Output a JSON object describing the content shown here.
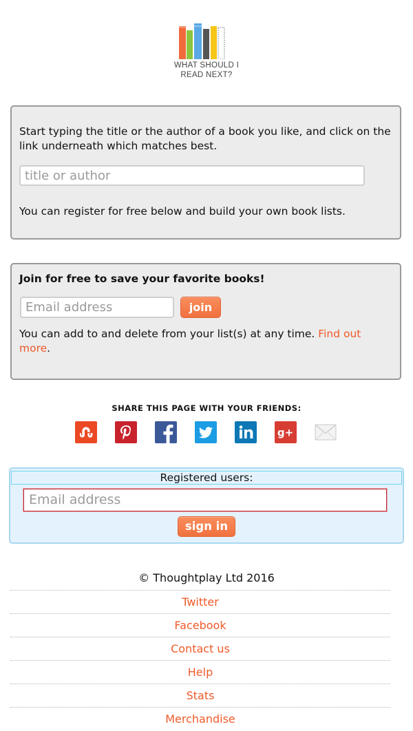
{
  "logo": {
    "line1": "WHAT SHOULD I",
    "line2": "READ NEXT?"
  },
  "search_panel": {
    "intro": "Start typing the title or the author of a book you like, and click on the link underneath which matches best.",
    "placeholder": "title or author",
    "register_note": "You can register for free below and build your own book lists."
  },
  "join_panel": {
    "title": "Join for free to save your favorite books!",
    "email_placeholder": "Email address",
    "join_label": "join",
    "note": "You can add to and delete from your list(s) at any time. ",
    "find_out_more": "Find out more",
    "period": "."
  },
  "share": {
    "title": "SHARE THIS PAGE WITH YOUR FRIENDS:",
    "icons": [
      "stumbleupon-icon",
      "pinterest-icon",
      "facebook-icon",
      "twitter-icon",
      "linkedin-icon",
      "google-plus-icon",
      "email-icon"
    ]
  },
  "registered": {
    "title": "Registered users:",
    "email_placeholder": "Email address",
    "signin_label": "sign in"
  },
  "footer": {
    "copyright": "© Thoughtplay Ltd 2016",
    "links": [
      "Twitter",
      "Facebook",
      "Contact us",
      "Help",
      "Stats",
      "Merchandise"
    ]
  },
  "colors": {
    "accent": "#ef5a2a",
    "button": "#f47e4b",
    "panel_bg": "#ececec",
    "register_bg": "#e4f2fd"
  }
}
